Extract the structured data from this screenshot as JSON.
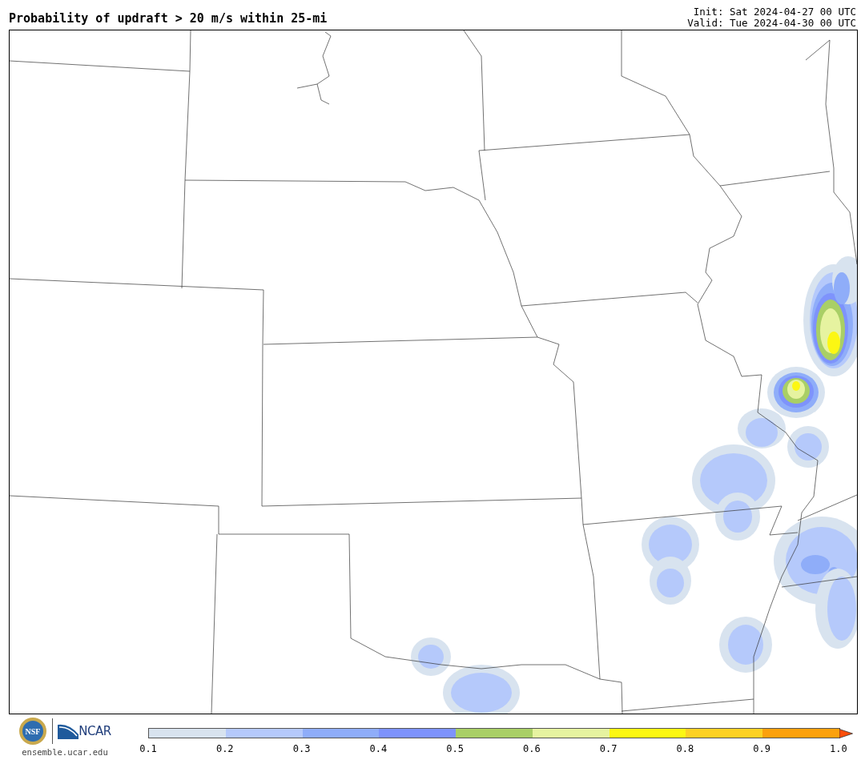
{
  "title": "Probability of updraft > 20 m/s within 25-mi",
  "init": "Init: Sat 2024-04-27 00 UTC",
  "valid": "Valid: Tue 2024-04-30 00 UTC",
  "logos": {
    "nsf": "NSF",
    "ncar": "NCAR",
    "website": "ensemble.ucar.edu"
  },
  "colorbar": {
    "bins": [
      {
        "color": "#d8e3ef"
      },
      {
        "color": "#b5c9fb"
      },
      {
        "color": "#8fadf9"
      },
      {
        "color": "#7e93fc"
      },
      {
        "color": "#a9cf66"
      },
      {
        "color": "#e6f3a0"
      },
      {
        "color": "#fcf713"
      },
      {
        "color": "#fdd124"
      },
      {
        "color": "#fca10d"
      }
    ],
    "extend": {
      "color": "#fc4e0a"
    },
    "ticks": [
      "0.1",
      "0.2",
      "0.3",
      "0.4",
      "0.5",
      "0.6",
      "0.7",
      "0.8",
      "0.9",
      "1.0"
    ]
  }
}
